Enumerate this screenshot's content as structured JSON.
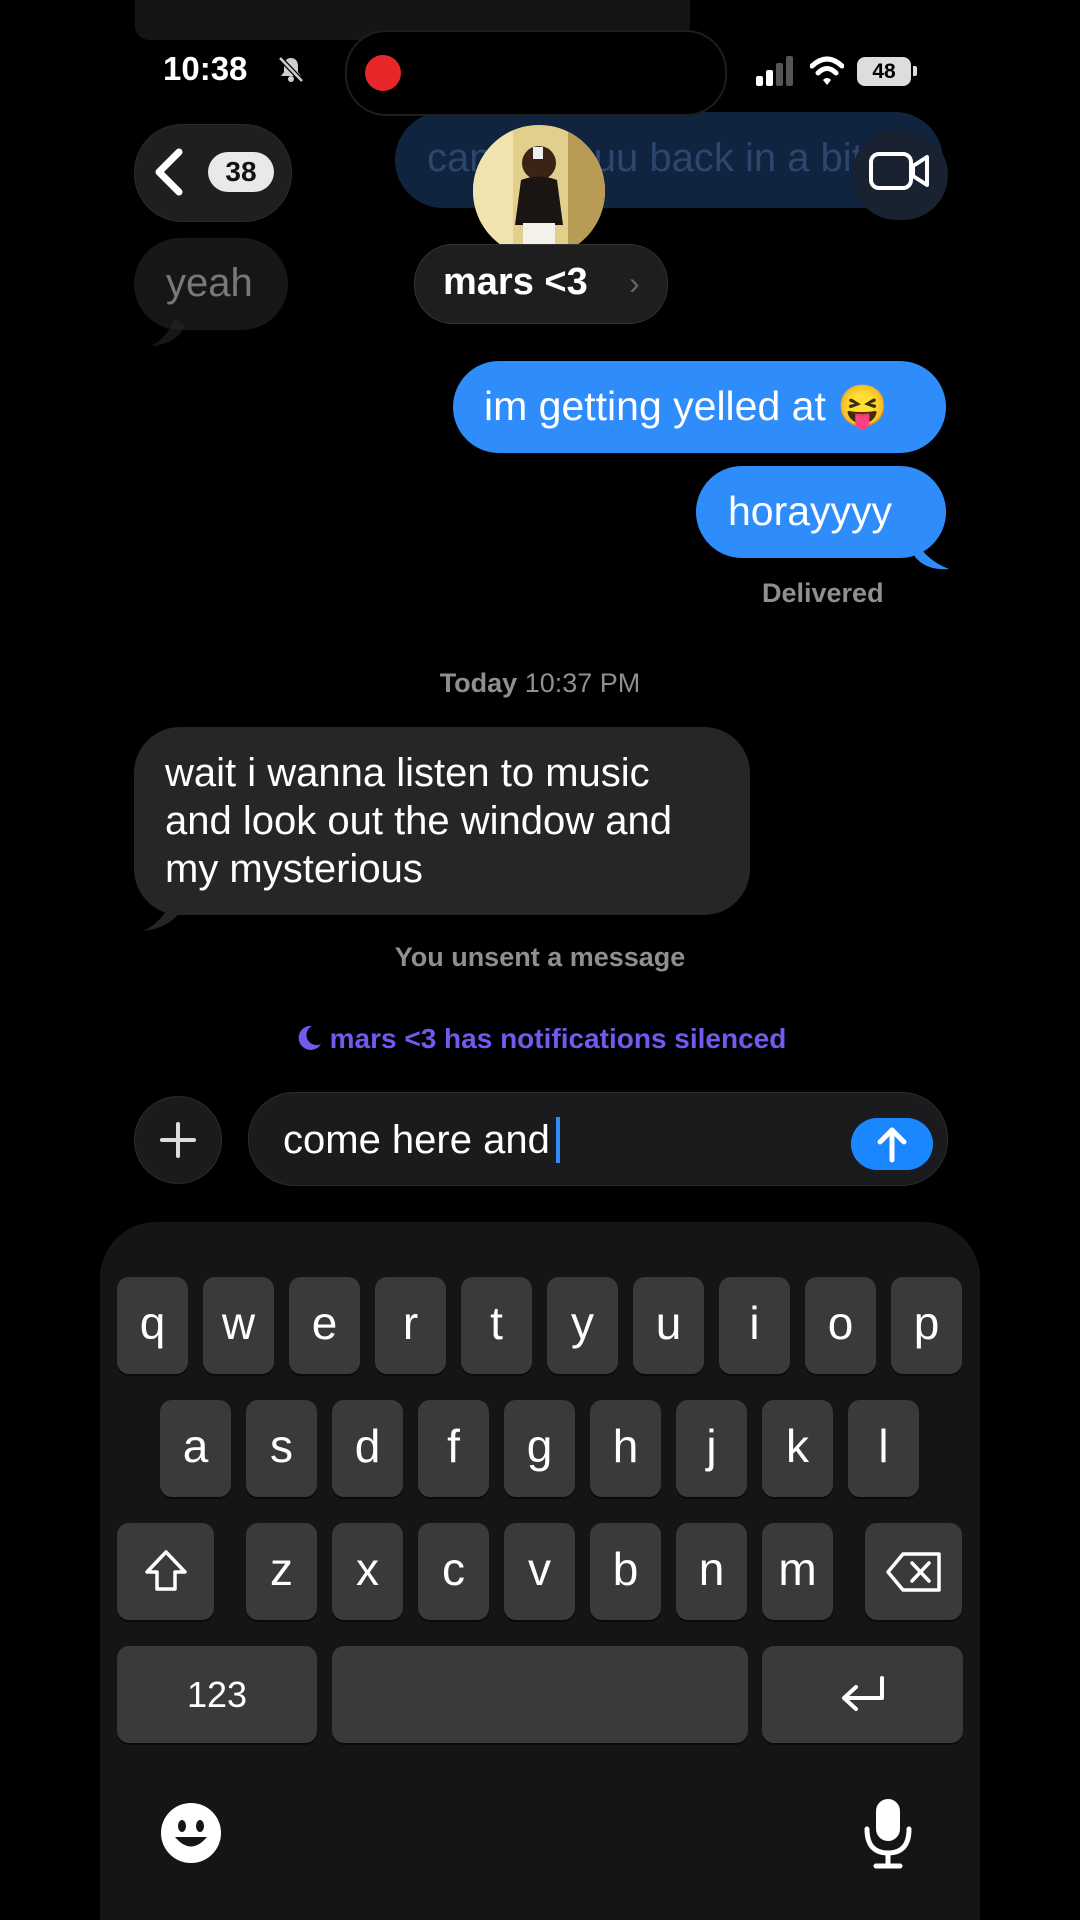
{
  "status_bar": {
    "time": "10:38",
    "battery": "48"
  },
  "header": {
    "back_count": "38",
    "contact_name": "mars <3",
    "name_chevron": "›",
    "faded_message": "can i call uu back in a bit"
  },
  "messages": {
    "yeah": "yeah",
    "blue_1": "im getting yelled at 😝",
    "blue_2": "horayyyy",
    "delivered": "Delivered",
    "timestamp_day": "Today",
    "timestamp_time": "10:37 PM",
    "gray_long_lines": [
      "wait i wanna listen to music",
      "and look out the window and",
      "my mysterious"
    ],
    "unsent": "You unsent a message",
    "silenced": "mars <3 has notifications silenced"
  },
  "composer": {
    "text": "come here and"
  },
  "keyboard": {
    "row1": [
      "q",
      "w",
      "e",
      "r",
      "t",
      "y",
      "u",
      "i",
      "o",
      "p"
    ],
    "row2": [
      "a",
      "s",
      "d",
      "f",
      "g",
      "h",
      "j",
      "k",
      "l"
    ],
    "row3": [
      "z",
      "x",
      "c",
      "v",
      "b",
      "n",
      "m"
    ],
    "numbers_label": "123"
  },
  "icons": {
    "bell": "bell-slash-icon",
    "record": "record-dot-icon",
    "video": "video-camera-icon",
    "send": "arrow-up-icon",
    "plus": "plus-icon",
    "shift": "shift-icon",
    "delete": "delete-icon",
    "return": "return-icon",
    "emoji": "emoji-icon",
    "mic": "microphone-icon",
    "moon": "moon-icon"
  },
  "colors": {
    "accent_blue": "#2f8dfb",
    "silenced_purple": "#6f5bf0",
    "record_red": "#e8272b"
  }
}
